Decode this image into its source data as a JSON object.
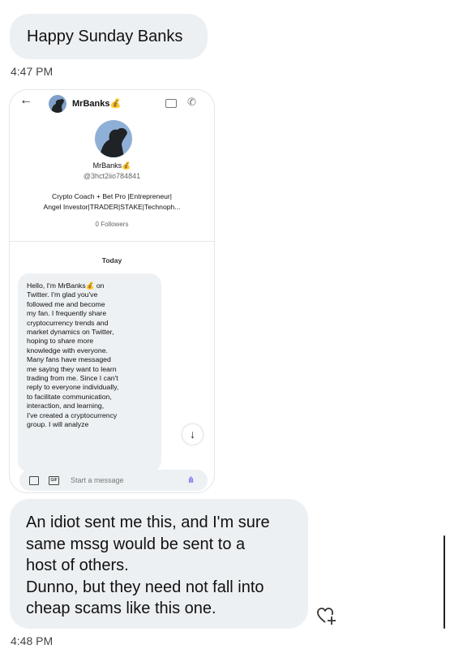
{
  "messages": {
    "first": {
      "text": "Happy Sunday Banks",
      "time": "4:47 PM"
    },
    "second": {
      "lines": [
        "An idiot sent me this, and I'm sure",
        "same mssg would be sent to a",
        "host of others.",
        "Dunno, but they need not fall into",
        "cheap scams like this one."
      ],
      "time": "4:48 PM"
    }
  },
  "screenshot": {
    "header": {
      "name": "MrBanks💰",
      "back_icon": "arrow-left-icon",
      "icons": [
        "video-call-icon",
        "phone-icon"
      ]
    },
    "profile": {
      "name": "MrBanks💰",
      "handle": "@3hct2iio784841",
      "bio_line1": "Crypto Coach + Bet Pro |Entrepreneur|",
      "bio_line2": "Angel Investor|TRADER|STAKE|Technoph...",
      "followers": "0 Followers"
    },
    "divider_label": "Today",
    "message_lines": [
      "Hello, I'm MrBanks💰 on",
      "Twitter. I'm glad you've",
      "followed me and become",
      "my fan. I frequently share",
      "cryptocurrency trends and",
      "market dynamics on Twitter,",
      "hoping to share more",
      "knowledge with everyone.",
      "Many fans have messaged",
      "me saying they want to learn",
      "trading from me. Since I can't",
      "reply to everyone individually,",
      "to facilitate communication,",
      "interaction, and learning,",
      "I've created a cryptocurrency",
      "group. I will analyze"
    ],
    "scroll_down_label": "↓",
    "composer": {
      "placeholder": "Start a message",
      "gif_label": "GIF"
    }
  }
}
